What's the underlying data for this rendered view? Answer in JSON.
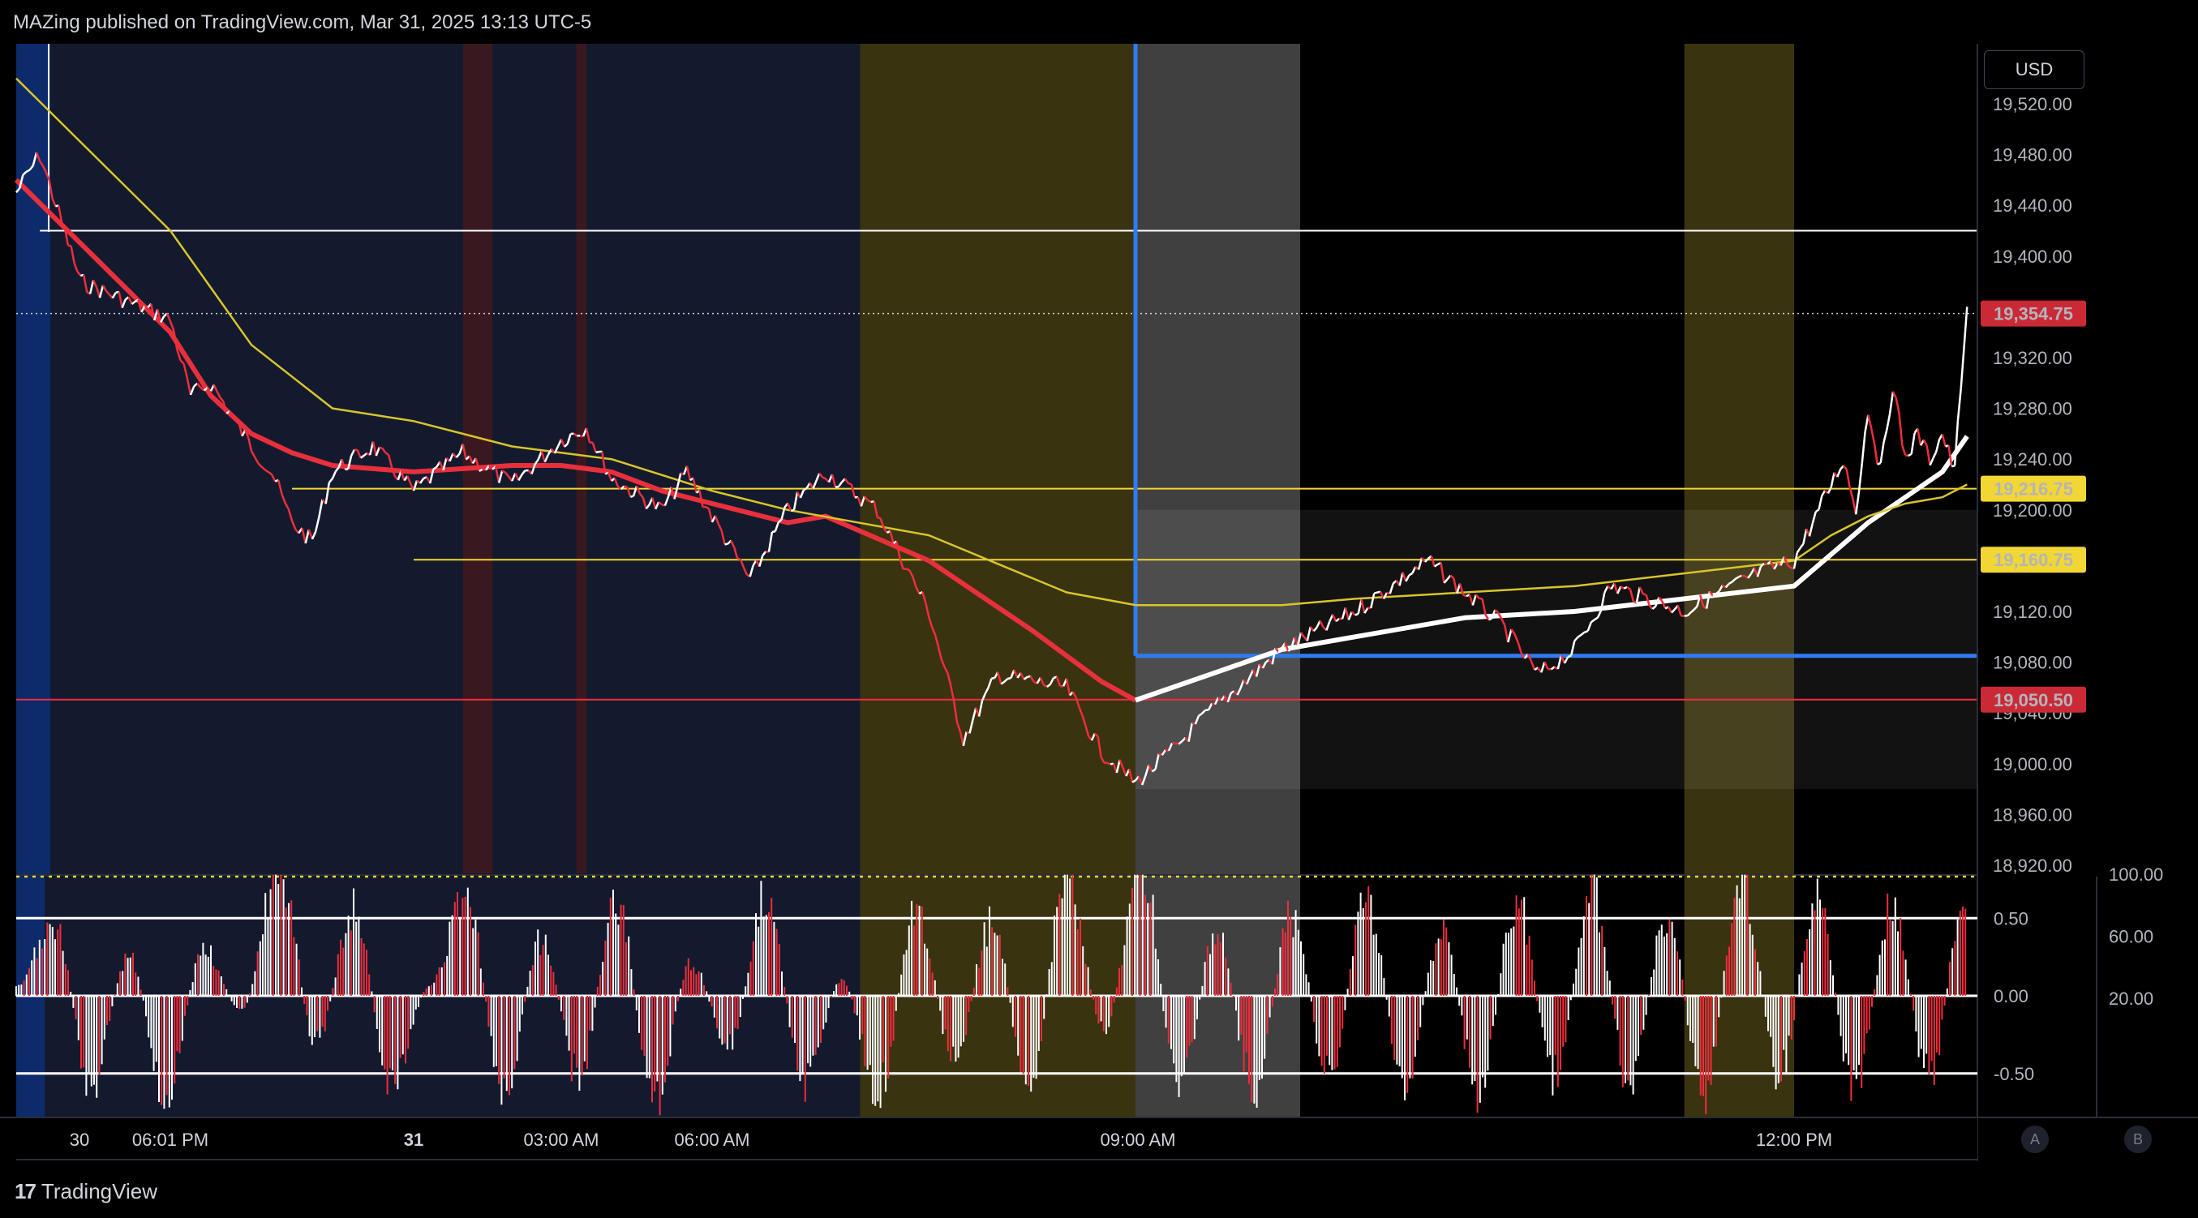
{
  "header": {
    "published_text": "MAZing published on TradingView.com, Mar 31, 2025 13:13 UTC-5"
  },
  "currency": "USD",
  "footer": {
    "brand": "TradingView"
  },
  "scale_buttons": {
    "auto": "A",
    "log": "B"
  },
  "colors": {
    "background": "#000000",
    "price_up": "#ffffff",
    "price_down": "#ef2d3b",
    "ema_red": "#e8303c",
    "sma_white": "#ffffff",
    "sma_yellow": "#d9c52a",
    "level_line": "#f2d633",
    "vertical_marker": "#2f7bf5",
    "last_price_label": "#cc2936",
    "session_night": "#141a2e",
    "session_premarket": "#3a3310",
    "session_opening": "#404040"
  },
  "chart_data": [
    {
      "type": "line",
      "title": "",
      "price_scale": {
        "currency": "USD",
        "ticks": [
          "19,520.00",
          "19,480.00",
          "19,440.00",
          "19,400.00",
          "19,320.00",
          "19,280.00",
          "19,240.00",
          "19,200.00",
          "19,120.00",
          "19,080.00",
          "19,040.00",
          "19,000.00",
          "18,960.00",
          "18,920.00"
        ],
        "ylim": [
          18920,
          19540
        ]
      },
      "time_axis": {
        "ticks": [
          "30",
          "06:01 PM",
          "31",
          "03:00 AM",
          "06:00 AM",
          "09:00 AM",
          "12:00 PM"
        ],
        "bold_ticks": [
          "31"
        ]
      },
      "price_labels": [
        {
          "value": "19,354.75",
          "style": "last_price"
        },
        {
          "value": "19,216.75",
          "style": "level"
        },
        {
          "value": "19,160.75",
          "style": "level"
        },
        {
          "value": "19,050.50",
          "style": "last_price"
        }
      ],
      "horizontal_levels": [
        {
          "value": 19420,
          "color": "#ffffff",
          "from": "Mar 30 16:30",
          "to": "Mar 31 13:13"
        },
        {
          "value": 19216.75,
          "color": "#f2d633",
          "from": "Mar 30 21:00",
          "to": "Mar 31 13:13"
        },
        {
          "value": 19160.75,
          "color": "#f2d633",
          "from": "Mar 31 00:00",
          "to": "Mar 31 13:13"
        },
        {
          "value": 19085,
          "color": "#2f7bf5",
          "from": "Mar 31 09:00",
          "to": "Mar 31 13:13"
        },
        {
          "value": 19050.5,
          "color": "#ef2d3b",
          "from": "Mar 30 16:00",
          "to": "Mar 31 13:13"
        }
      ],
      "vertical_marker": "Mar 31 09:00",
      "sessions": [
        {
          "from": "Mar 30 16:00",
          "to": "Mar 30 16:40",
          "kind": "open-blue"
        },
        {
          "from": "Mar 30 16:40",
          "to": "Mar 31 07:40",
          "kind": "night"
        },
        {
          "from": "Mar 31 07:40",
          "to": "Mar 31 09:00",
          "kind": "premarket"
        },
        {
          "from": "Mar 31 09:00",
          "to": "Mar 31 09:45",
          "kind": "opening"
        },
        {
          "from": "Mar 31 11:30",
          "to": "Mar 31 12:00",
          "kind": "premarket"
        }
      ],
      "last_price": 19354.75,
      "series": [
        {
          "kind": "price",
          "points": [
            [
              "Mar 30 16:00",
              19450
            ],
            [
              "Mar 30 16:30",
              19480
            ],
            [
              "Mar 30 17:00",
              19380
            ],
            [
              "Mar 30 18:00",
              19350
            ],
            [
              "Mar 30 18:30",
              19290
            ],
            [
              "Mar 30 19:00",
              19300
            ],
            [
              "Mar 30 20:00",
              19250
            ],
            [
              "Mar 30 20:30",
              19230
            ],
            [
              "Mar 30 21:00",
              19190
            ],
            [
              "Mar 30 21:30",
              19175
            ],
            [
              "Mar 30 22:00",
              19230
            ],
            [
              "Mar 30 23:00",
              19250
            ],
            [
              "Mar 31 00:00",
              19215
            ],
            [
              "Mar 31 01:00",
              19245
            ],
            [
              "Mar 31 02:00",
              19220
            ],
            [
              "Mar 31 03:00",
              19255
            ],
            [
              "Mar 31 03:30",
              19265
            ],
            [
              "Mar 31 04:00",
              19225
            ],
            [
              "Mar 31 05:00",
              19200
            ],
            [
              "Mar 31 05:30",
              19230
            ],
            [
              "Mar 31 06:00",
              19195
            ],
            [
              "Mar 31 06:30",
              19145
            ],
            [
              "Mar 31 07:00",
              19200
            ],
            [
              "Mar 31 07:30",
              19230
            ],
            [
              "Mar 31 07:45",
              19200
            ],
            [
              "Mar 31 08:00",
              19120
            ],
            [
              "Mar 31 08:10",
              19020
            ],
            [
              "Mar 31 08:20",
              19070
            ],
            [
              "Mar 31 08:40",
              19060
            ],
            [
              "Mar 31 08:50",
              19010
            ],
            [
              "Mar 31 09:00",
              18985
            ],
            [
              "Mar 31 09:10",
              19010
            ],
            [
              "Mar 31 09:20",
              19040
            ],
            [
              "Mar 31 09:40",
              19090
            ],
            [
              "Mar 31 10:00",
              19120
            ],
            [
              "Mar 31 10:20",
              19160
            ],
            [
              "Mar 31 10:40",
              19110
            ],
            [
              "Mar 31 10:50",
              19070
            ],
            [
              "Mar 31 11:00",
              19090
            ],
            [
              "Mar 31 11:10",
              19140
            ],
            [
              "Mar 31 11:30",
              19120
            ],
            [
              "Mar 31 11:50",
              19150
            ],
            [
              "Mar 31 12:00",
              19160
            ],
            [
              "Mar 31 12:20",
              19200
            ],
            [
              "Mar 31 12:40",
              19240
            ],
            [
              "Mar 31 12:50",
              19200
            ],
            [
              "Mar 31 13:00",
              19280
            ],
            [
              "Mar 31 13:10",
              19230
            ],
            [
              "Mar 31 13:20",
              19300
            ],
            [
              "Mar 31 13:30",
              19240
            ],
            [
              "Mar 31 13:40",
              19260
            ],
            [
              "Mar 31 13:50",
              19240
            ],
            [
              "Mar 31 14:00",
              19260
            ],
            [
              "Mar 31 14:10",
              19230
            ],
            [
              "Mar 31 14:15",
              19300
            ],
            [
              "Mar 31 14:20",
              19360
            ]
          ]
        },
        {
          "kind": "ema",
          "color": "#e8303c",
          "points": [
            [
              "Mar 30 16:00",
              19460
            ],
            [
              "Mar 30 17:00",
              19410
            ],
            [
              "Mar 30 18:00",
              19340
            ],
            [
              "Mar 30 19:00",
              19290
            ],
            [
              "Mar 30 20:00",
              19260
            ],
            [
              "Mar 30 21:00",
              19245
            ],
            [
              "Mar 30 22:00",
              19235
            ],
            [
              "Mar 31 00:00",
              19230
            ],
            [
              "Mar 31 02:00",
              19235
            ],
            [
              "Mar 31 03:00",
              19235
            ],
            [
              "Mar 31 04:00",
              19230
            ],
            [
              "Mar 31 05:00",
              19215
            ],
            [
              "Mar 31 06:00",
              19205
            ],
            [
              "Mar 31 07:00",
              19190
            ],
            [
              "Mar 31 07:30",
              19195
            ],
            [
              "Mar 31 08:00",
              19160
            ],
            [
              "Mar 31 08:30",
              19105
            ],
            [
              "Mar 31 08:50",
              19065
            ],
            [
              "Mar 31 09:00",
              19050
            ]
          ]
        },
        {
          "kind": "sma",
          "color": "#ffffff",
          "points": [
            [
              "Mar 31 09:00",
              19050
            ],
            [
              "Mar 31 09:20",
              19070
            ],
            [
              "Mar 31 09:40",
              19090
            ],
            [
              "Mar 31 10:00",
              19100
            ],
            [
              "Mar 31 10:30",
              19115
            ],
            [
              "Mar 31 11:00",
              19120
            ],
            [
              "Mar 31 11:30",
              19130
            ],
            [
              "Mar 31 12:00",
              19140
            ],
            [
              "Mar 31 12:30",
              19165
            ],
            [
              "Mar 31 13:00",
              19190
            ],
            [
              "Mar 31 13:30",
              19210
            ],
            [
              "Mar 31 14:00",
              19230
            ],
            [
              "Mar 31 14:20",
              19258
            ]
          ]
        },
        {
          "kind": "sma",
          "color": "#d9c52a",
          "points": [
            [
              "Mar 30 16:00",
              19540
            ],
            [
              "Mar 30 18:00",
              19420
            ],
            [
              "Mar 30 20:00",
              19330
            ],
            [
              "Mar 30 22:00",
              19280
            ],
            [
              "Mar 31 00:00",
              19270
            ],
            [
              "Mar 31 02:00",
              19250
            ],
            [
              "Mar 31 04:00",
              19240
            ],
            [
              "Mar 31 06:00",
              19215
            ],
            [
              "Mar 31 07:00",
              19200
            ],
            [
              "Mar 31 08:00",
              19180
            ],
            [
              "Mar 31 08:40",
              19135
            ],
            [
              "Mar 31 09:00",
              19125
            ],
            [
              "Mar 31 09:40",
              19125
            ],
            [
              "Mar 31 10:00",
              19130
            ],
            [
              "Mar 31 11:00",
              19140
            ],
            [
              "Mar 31 12:00",
              19160
            ],
            [
              "Mar 31 12:30",
              19180
            ],
            [
              "Mar 31 13:00",
              19195
            ],
            [
              "Mar 31 13:30",
              19205
            ],
            [
              "Mar 31 14:00",
              19210
            ],
            [
              "Mar 31 14:20",
              19220
            ]
          ]
        }
      ]
    },
    {
      "type": "bar",
      "title": "",
      "left_scale": {
        "ticks": [
          "0.50",
          "0.00",
          "-0.50"
        ],
        "ylim": [
          -0.8,
          0.8
        ]
      },
      "right_scale": {
        "ticks": [
          "100.00",
          "60.00",
          "20.00"
        ],
        "ylim": [
          0,
          100
        ]
      },
      "reference_lines": [
        0.5,
        0.0,
        -0.5
      ],
      "dotted_top_line": 100,
      "histogram_colors": [
        "#ffffff",
        "#ef2d3b"
      ],
      "oscillator_color": "#f2d633",
      "oscillator_swings": [
        0.05,
        0.45,
        -0.55,
        0.25,
        -0.62,
        0.3,
        -0.1,
        0.82,
        -0.3,
        0.55,
        -0.55,
        0.05,
        0.6,
        -0.6,
        0.35,
        -0.5,
        0.6,
        -0.65,
        0.2,
        -0.3,
        0.62,
        -0.55,
        0.1,
        -0.6,
        0.55,
        -0.4,
        0.45,
        -0.55,
        0.7,
        -0.2,
        0.8,
        -0.6,
        0.4,
        -0.58,
        0.5,
        -0.5,
        0.6,
        -0.55,
        0.4,
        -0.6,
        0.6,
        -0.5,
        0.65,
        -0.55,
        0.5,
        -0.6,
        0.75,
        -0.5,
        0.62,
        -0.58,
        0.55,
        -0.5,
        0.7
      ]
    }
  ]
}
